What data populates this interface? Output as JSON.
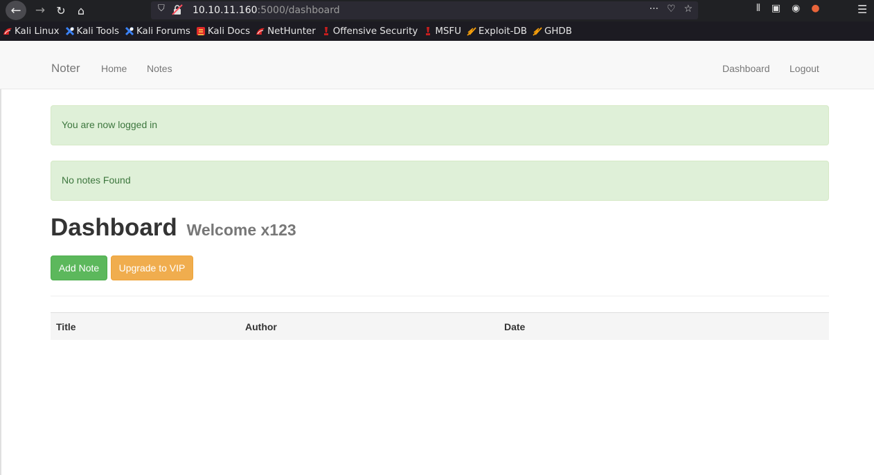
{
  "browser": {
    "back_glyph": "←",
    "forward_glyph": "→",
    "reload_glyph": "↻",
    "home_glyph": "⌂",
    "shield_glyph": "⛉",
    "url_host": "10.10.11.160",
    "url_rest": ":5000/dashboard",
    "url_actions": [
      "···",
      "♡",
      "☆"
    ],
    "right_tools": [
      "⫴",
      "▣",
      "◉",
      "●"
    ],
    "menu_glyph": "☰",
    "bookmarks": [
      {
        "label": "Kali Linux",
        "color": "#e02a2a"
      },
      {
        "label": "Kali Tools",
        "color": "#3b82f6"
      },
      {
        "label": "Kali Forums",
        "color": "#3b82f6"
      },
      {
        "label": "Kali Docs",
        "color": "#e02a2a"
      },
      {
        "label": "NetHunter",
        "color": "#e02a2a"
      },
      {
        "label": "Offensive Security",
        "color": "#c81e1e"
      },
      {
        "label": "MSFU",
        "color": "#c81e1e"
      },
      {
        "label": "Exploit-DB",
        "color": "#f59e0b"
      },
      {
        "label": "GHDB",
        "color": "#f59e0b"
      }
    ]
  },
  "navbar": {
    "brand": "Noter",
    "home": "Home",
    "notes": "Notes",
    "dashboard": "Dashboard",
    "logout": "Logout"
  },
  "alerts": {
    "login": "You are now logged in",
    "no_notes": "No notes Found"
  },
  "dashboard": {
    "title": "Dashboard",
    "welcome": "Welcome x123",
    "add_note": "Add Note",
    "upgrade": "Upgrade to VIP"
  },
  "table": {
    "headers": [
      "Title",
      "Author",
      "Date"
    ]
  },
  "colors": {
    "success": "#5cb85c",
    "warning": "#f0ad4e",
    "alert_bg": "#dff0d8",
    "alert_text": "#3c763d"
  }
}
